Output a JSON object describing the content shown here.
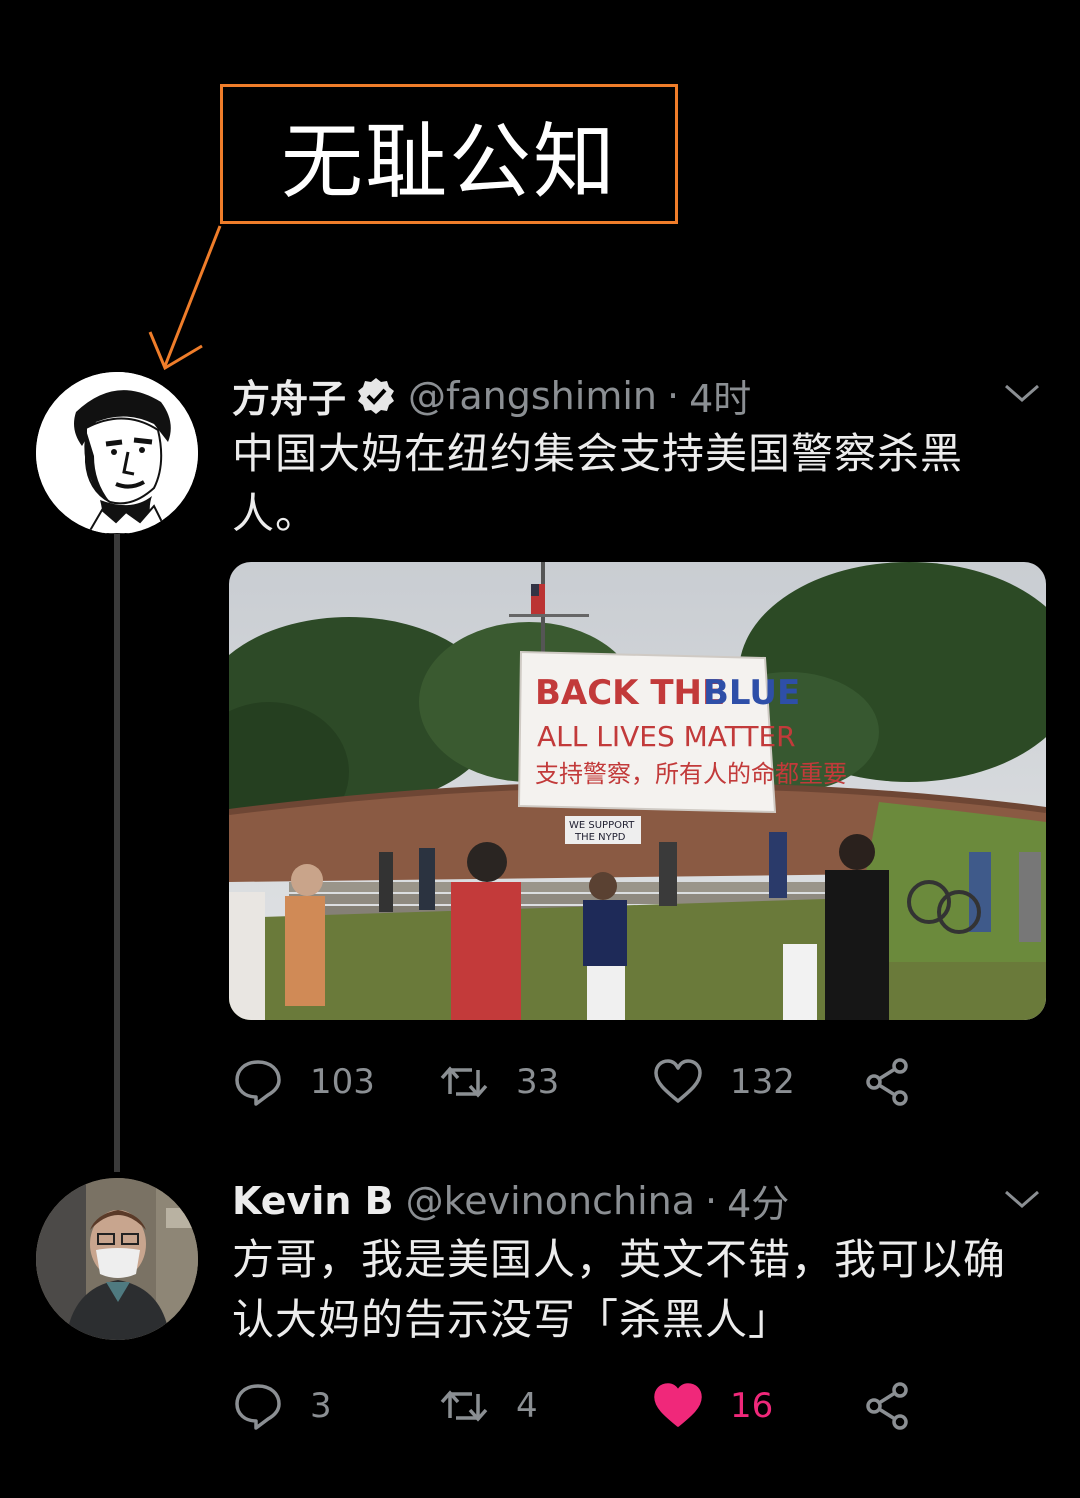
{
  "annotation": {
    "label": "无耻公知",
    "border_color": "#ef7d2a"
  },
  "tweets": [
    {
      "name": "方舟子",
      "verified": true,
      "handle": "@fangshimin",
      "separator": "·",
      "time": "4时",
      "text": "中国大妈在纽约集会支持美国警察杀黑人。",
      "image": {
        "banner_lines": [
          "BACK THE BLUE",
          "ALL LIVES MATTER",
          "支持警察，所有人的命都重要"
        ],
        "small_sign": "WE SUPPORT THE NYPD"
      },
      "actions": {
        "replies": "103",
        "retweets": "33",
        "likes": "132",
        "liked": false
      }
    },
    {
      "name": "Kevin B",
      "verified": false,
      "handle": "@kevinonchina",
      "separator": "·",
      "time": "4分",
      "text": "方哥，我是美国人，英文不错，我可以确认大妈的告示没写「杀黑人」",
      "actions": {
        "replies": "3",
        "retweets": "4",
        "likes": "16",
        "liked": true
      }
    }
  ],
  "icons": {
    "reply": "speech-bubble-icon",
    "retweet": "retweet-icon",
    "like": "heart-icon",
    "share": "share-icon",
    "menu": "chevron-down-icon",
    "verified": "verified-badge-icon"
  },
  "colors": {
    "background": "#000000",
    "muted": "#8b8f93",
    "like_active": "#f0287a",
    "annotation": "#ef7d2a"
  }
}
